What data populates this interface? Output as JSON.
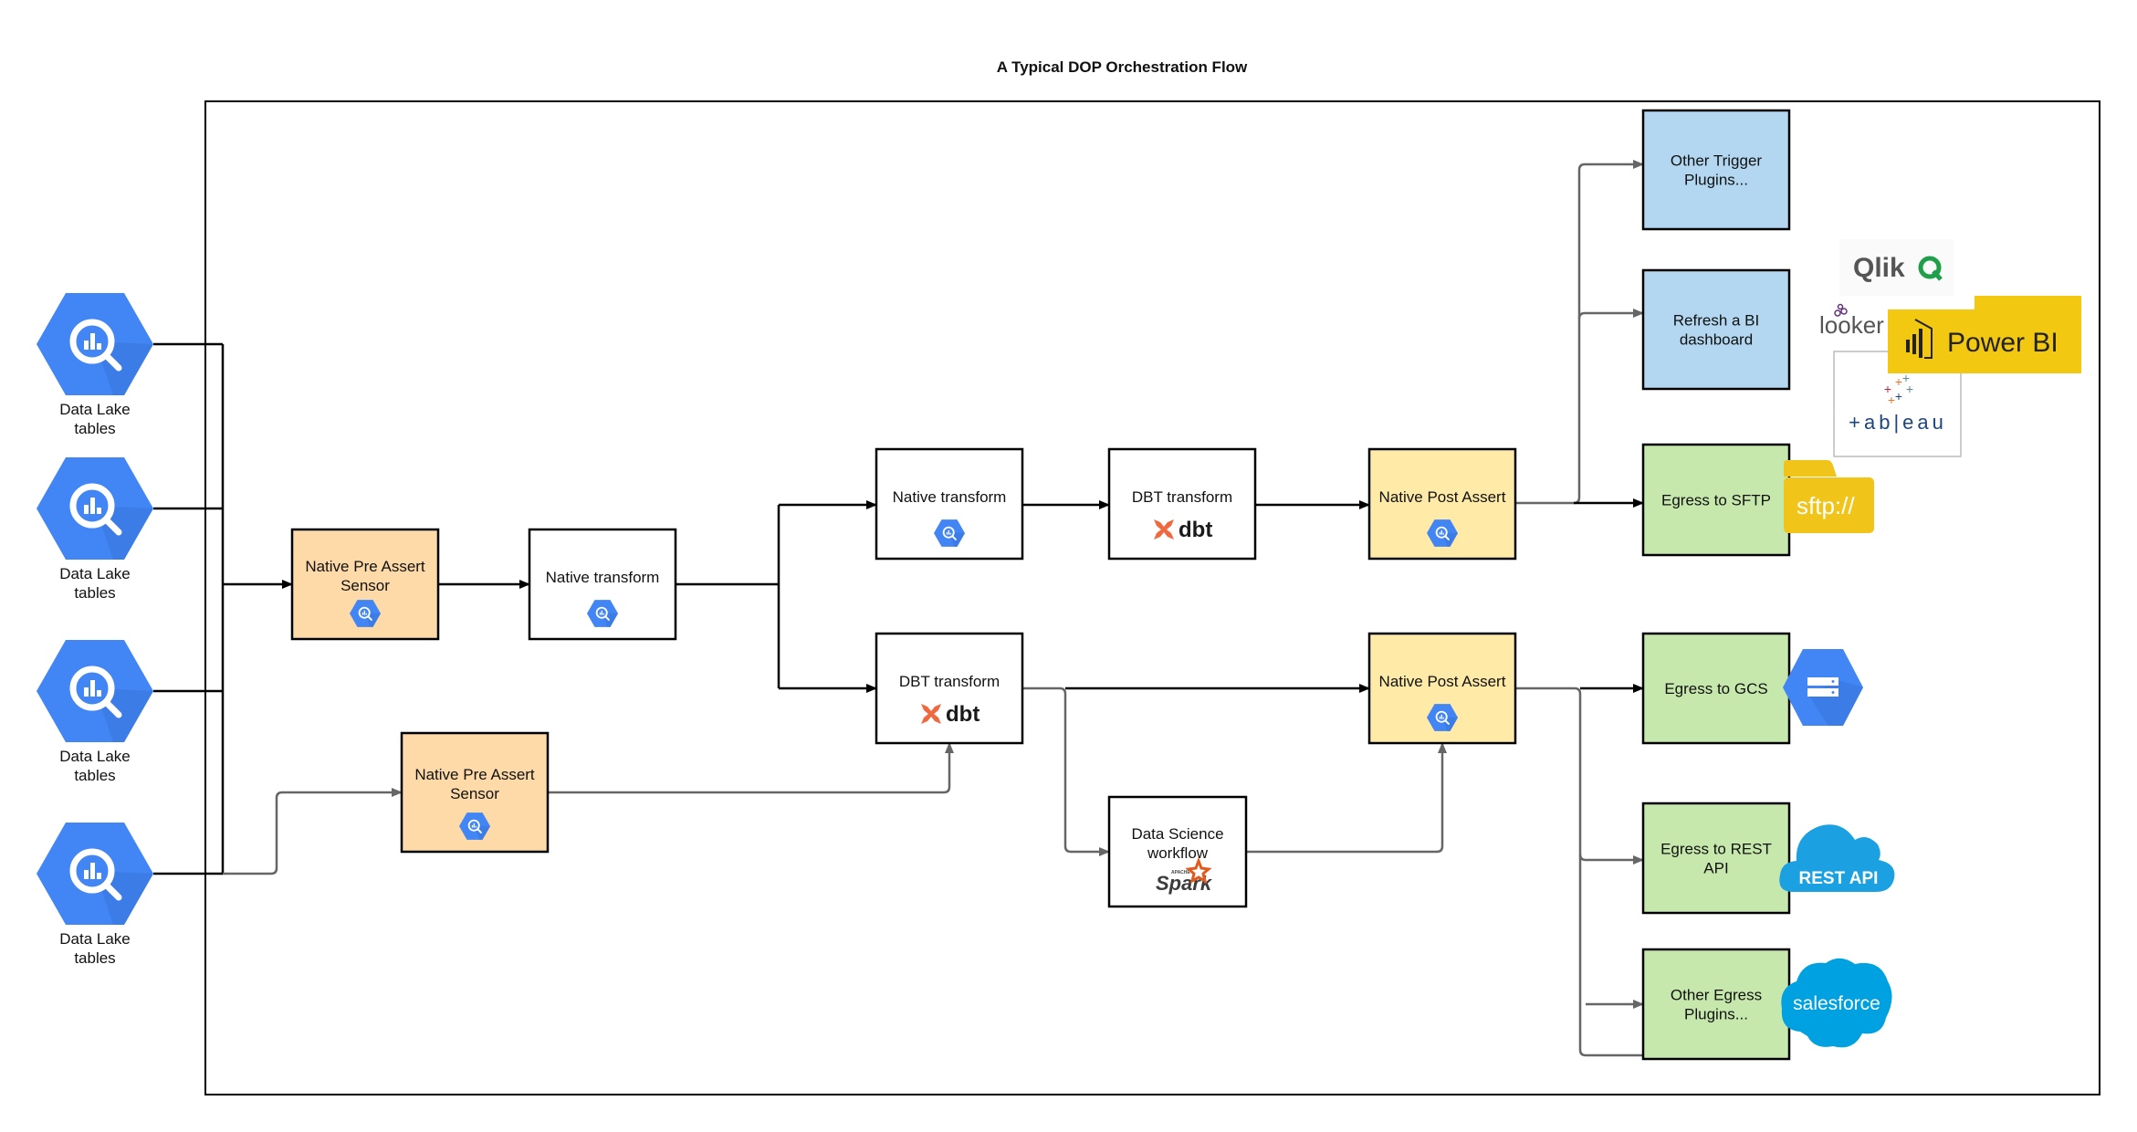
{
  "title": "A Typical DOP Orchestration Flow",
  "colors": {
    "bigquery_blue": "#4285f4",
    "bigquery_shadow": "#3b78e0",
    "pre_assert_fill": "#fedaa8",
    "post_assert_fill": "#ffeaa7",
    "trigger_fill": "#b3d7f0",
    "egress_fill": "#c7e8ad",
    "transform_fill": "#ffffff",
    "edge_black": "#000000",
    "edge_gray": "#666666",
    "dbt_orange": "#f0683e",
    "powerbi_yellow": "#f2c811",
    "sftp_yellow": "#f0c419",
    "qlik_green": "#1f9f4a",
    "looker_purple": "#64307d",
    "cloud_blue": "#1ba1e2",
    "salesforce_blue": "#00a1e0"
  },
  "sources": [
    {
      "id": "src1",
      "label_line1": "Data Lake",
      "label_line2": "tables",
      "icon": "bigquery-icon"
    },
    {
      "id": "src2",
      "label_line1": "Data Lake",
      "label_line2": "tables",
      "icon": "bigquery-icon"
    },
    {
      "id": "src3",
      "label_line1": "Data Lake",
      "label_line2": "tables",
      "icon": "bigquery-icon"
    },
    {
      "id": "src4",
      "label_line1": "Data Lake",
      "label_line2": "tables",
      "icon": "bigquery-icon"
    }
  ],
  "nodes": [
    {
      "id": "pre1",
      "lines": [
        "Native Pre Assert",
        "Sensor"
      ],
      "kind": "pre_assert",
      "icon": "bigquery-icon"
    },
    {
      "id": "nt1",
      "lines": [
        "Native transform"
      ],
      "kind": "transform",
      "icon": "bigquery-icon"
    },
    {
      "id": "nt2",
      "lines": [
        "Native transform"
      ],
      "kind": "transform",
      "icon": "bigquery-icon"
    },
    {
      "id": "dbt1",
      "lines": [
        "DBT transform"
      ],
      "kind": "transform",
      "icon": "dbt-logo-icon"
    },
    {
      "id": "post1",
      "lines": [
        "Native Post Assert"
      ],
      "kind": "post_assert",
      "icon": "bigquery-icon"
    },
    {
      "id": "dbt2",
      "lines": [
        "DBT transform"
      ],
      "kind": "transform",
      "icon": "dbt-logo-icon"
    },
    {
      "id": "pre2",
      "lines": [
        "Native Pre Assert",
        "Sensor"
      ],
      "kind": "pre_assert",
      "icon": "bigquery-icon"
    },
    {
      "id": "ds",
      "lines": [
        "Data Science",
        "workflow"
      ],
      "kind": "transform",
      "icon": "spark-logo-icon"
    },
    {
      "id": "post2",
      "lines": [
        "Native Post Assert"
      ],
      "kind": "post_assert",
      "icon": "bigquery-icon"
    },
    {
      "id": "trig",
      "lines": [
        "Other Trigger",
        "Plugins..."
      ],
      "kind": "trigger",
      "icon": null
    },
    {
      "id": "bi",
      "lines": [
        "Refresh a BI",
        "dashboard"
      ],
      "kind": "trigger",
      "icon": null
    },
    {
      "id": "sftp",
      "lines": [
        "Egress to SFTP"
      ],
      "kind": "egress",
      "icon": null
    },
    {
      "id": "gcs",
      "lines": [
        "Egress to GCS"
      ],
      "kind": "egress",
      "icon": null
    },
    {
      "id": "rest",
      "lines": [
        "Egress to REST",
        "API"
      ],
      "kind": "egress",
      "icon": null
    },
    {
      "id": "other",
      "lines": [
        "Other Egress",
        "Plugins..."
      ],
      "kind": "egress",
      "icon": null
    }
  ],
  "edges": [
    {
      "from": "sources-bus",
      "to": "pre1",
      "style": "black"
    },
    {
      "from": "src4",
      "to": "pre2",
      "style": "gray"
    },
    {
      "from": "pre1",
      "to": "nt1",
      "style": "black"
    },
    {
      "from": "nt1",
      "to": "nt2",
      "style": "black"
    },
    {
      "from": "nt1",
      "to": "dbt2",
      "style": "black"
    },
    {
      "from": "nt2",
      "to": "dbt1",
      "style": "black"
    },
    {
      "from": "dbt1",
      "to": "post1",
      "style": "black"
    },
    {
      "from": "pre2",
      "to": "dbt2",
      "style": "gray"
    },
    {
      "from": "dbt2",
      "to": "post2",
      "style": "black"
    },
    {
      "from": "dbt2",
      "to": "ds",
      "style": "gray"
    },
    {
      "from": "ds",
      "to": "post2",
      "style": "gray"
    },
    {
      "from": "post1",
      "to": "trig",
      "style": "gray"
    },
    {
      "from": "post1",
      "to": "bi",
      "style": "gray"
    },
    {
      "from": "post1",
      "to": "sftp",
      "style": "black"
    },
    {
      "from": "post2",
      "to": "gcs",
      "style": "black"
    },
    {
      "from": "post2",
      "to": "rest",
      "style": "gray"
    },
    {
      "from": "post2",
      "to": "other",
      "style": "gray"
    }
  ],
  "logos": {
    "qlik": "Qlik",
    "looker": "looker",
    "powerbi": "Power BI",
    "tableau": "+ab|eau",
    "sftp": "sftp://",
    "rest_api": "REST API",
    "salesforce": "salesforce",
    "dbt": "dbt",
    "spark": "Spark",
    "spark_apache": "APACHE"
  }
}
